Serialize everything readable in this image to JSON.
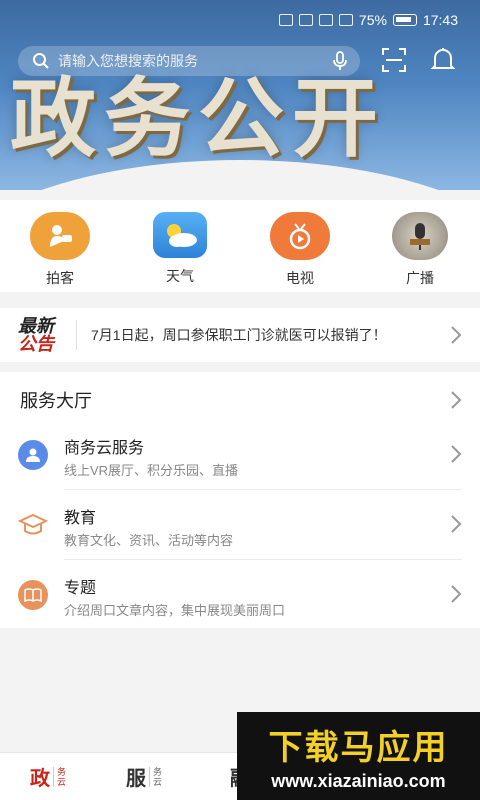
{
  "status_bar": {
    "battery": "75%",
    "time": "17:43"
  },
  "hero": {
    "title": "政务公开"
  },
  "search": {
    "placeholder": "请输入您想搜索的服务"
  },
  "quick_menu": [
    {
      "label": "拍客",
      "icon": "camera-person-icon",
      "color": "#f0a23a"
    },
    {
      "label": "天气",
      "icon": "weather-icon",
      "color": "#5aa8f0"
    },
    {
      "label": "电视",
      "icon": "tv-icon",
      "color": "#f07a3a"
    },
    {
      "label": "广播",
      "icon": "radio-icon",
      "color": "#b0b0b0"
    }
  ],
  "notice": {
    "logo_line1": "最新",
    "logo_line2": "公告",
    "text": "7月1日起，周口参保职工门诊就医可以报销了！"
  },
  "service_hall": {
    "title": "服务大厅",
    "items": [
      {
        "title": "商务云服务",
        "subtitle": "线上VR展厅、积分乐园、直播",
        "icon": "user-card-icon",
        "color": "#5b8be8"
      },
      {
        "title": "教育",
        "subtitle": "教育文化、资讯、活动等内容",
        "icon": "graduation-cap-icon",
        "color": "#e8935b"
      },
      {
        "title": "专题",
        "subtitle": "介绍周口文章内容，集中展现美丽周口",
        "icon": "book-icon",
        "color": "#e8935b"
      }
    ]
  },
  "bottom_nav": [
    {
      "big": "政",
      "small1": "务",
      "small2": "云",
      "active": true
    },
    {
      "big": "服",
      "small1": "务",
      "small2": "云",
      "active": false
    },
    {
      "big": "融",
      "small1": "",
      "small2": "",
      "active": false
    }
  ],
  "watermark": {
    "line1": "下载马应用",
    "line2": "www.xiazainiao.com"
  },
  "accent_color": "#c9251b"
}
